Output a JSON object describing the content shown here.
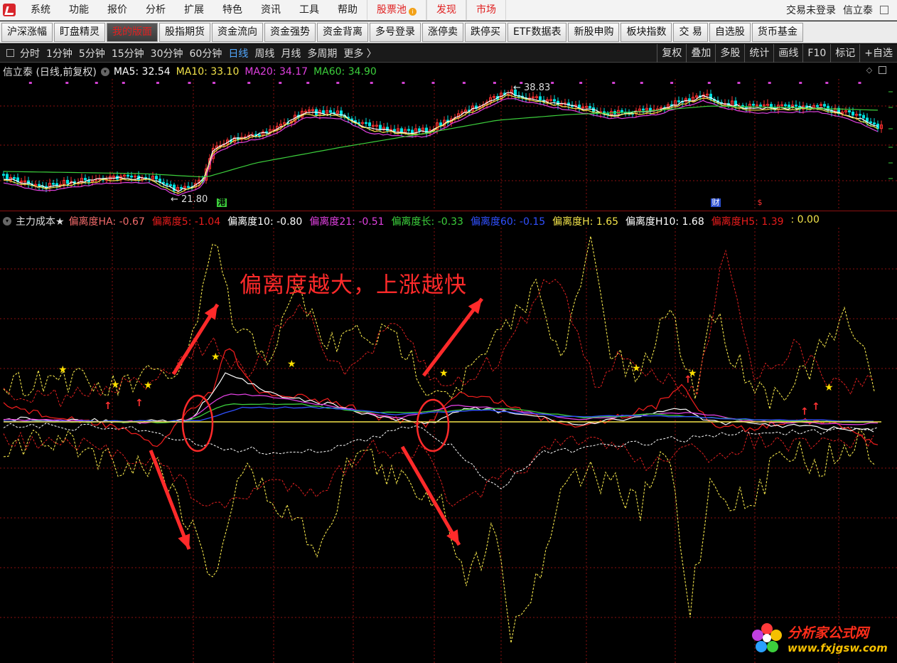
{
  "menubar": {
    "items": [
      "系统",
      "功能",
      "报价",
      "分析",
      "扩展",
      "特色",
      "资讯",
      "工具",
      "帮助"
    ],
    "red_items": [
      "股票池",
      "发现",
      "市场"
    ],
    "login_status": "交易未登录",
    "stock_name": "信立泰"
  },
  "toolbar": {
    "buttons": [
      "沪深涨幅",
      "盯盘精灵",
      "我的版面",
      "股指期货",
      "资金流向",
      "资金强势",
      "资金背离",
      "多号登录",
      "涨停卖",
      "跌停买",
      "ETF数据表",
      "新股申购",
      "板块指数",
      "交 易",
      "自选股",
      "货币基金"
    ],
    "active_index": 2
  },
  "periodbar": {
    "periods": [
      "分时",
      "1分钟",
      "5分钟",
      "15分钟",
      "30分钟",
      "60分钟",
      "日线",
      "周线",
      "月线",
      "多周期",
      "更多 〉"
    ],
    "selected": "日线",
    "right_buttons": [
      "复权",
      "叠加",
      "多股",
      "统计",
      "画线",
      "F10",
      "标记",
      "+自选"
    ]
  },
  "price_panel": {
    "title": "信立泰 (日线,前复权)",
    "ma": [
      {
        "label": "MA5: 32.54",
        "color": "#ffffff"
      },
      {
        "label": "MA10: 33.10",
        "color": "#f2e34a"
      },
      {
        "label": "MA20: 34.17",
        "color": "#e040e0"
      },
      {
        "label": "MA60: 34.90",
        "color": "#3ccf3c"
      }
    ],
    "high_label": "38.83",
    "low_label": "21.80",
    "markers": [
      "港",
      "财",
      "$"
    ]
  },
  "indicator_panel": {
    "name": "主力成本★",
    "lines": [
      {
        "label": "偏离度HA: -0.67",
        "color": "#f06a6a"
      },
      {
        "label": "偏离度5: -1.04",
        "color": "#e81c1c"
      },
      {
        "label": "偏离度10: -0.80",
        "color": "#ffffff"
      },
      {
        "label": "偏离度21: -0.51",
        "color": "#e040e0"
      },
      {
        "label": "偏离度长: -0.33",
        "color": "#3ccf3c"
      },
      {
        "label": "偏离度60: -0.15",
        "color": "#3050ff"
      },
      {
        "label": "偏离度H: 1.65",
        "color": "#f2e34a"
      },
      {
        "label": "偏离度H10: 1.68",
        "color": "#ffffff"
      },
      {
        "label": "偏离度H5: 1.39",
        "color": "#e81c1c"
      },
      {
        "label": ": 0.00",
        "color": "#f2e34a"
      }
    ],
    "annotation": "偏离度越大，上涨越快"
  },
  "watermark": {
    "title": "分析家公式网",
    "url": "www.fxjgsw.com"
  },
  "colors": {
    "up": "#ff3232",
    "down": "#00e0e0",
    "grid": "#8a1010",
    "annotation": "#ff2a2a"
  }
}
